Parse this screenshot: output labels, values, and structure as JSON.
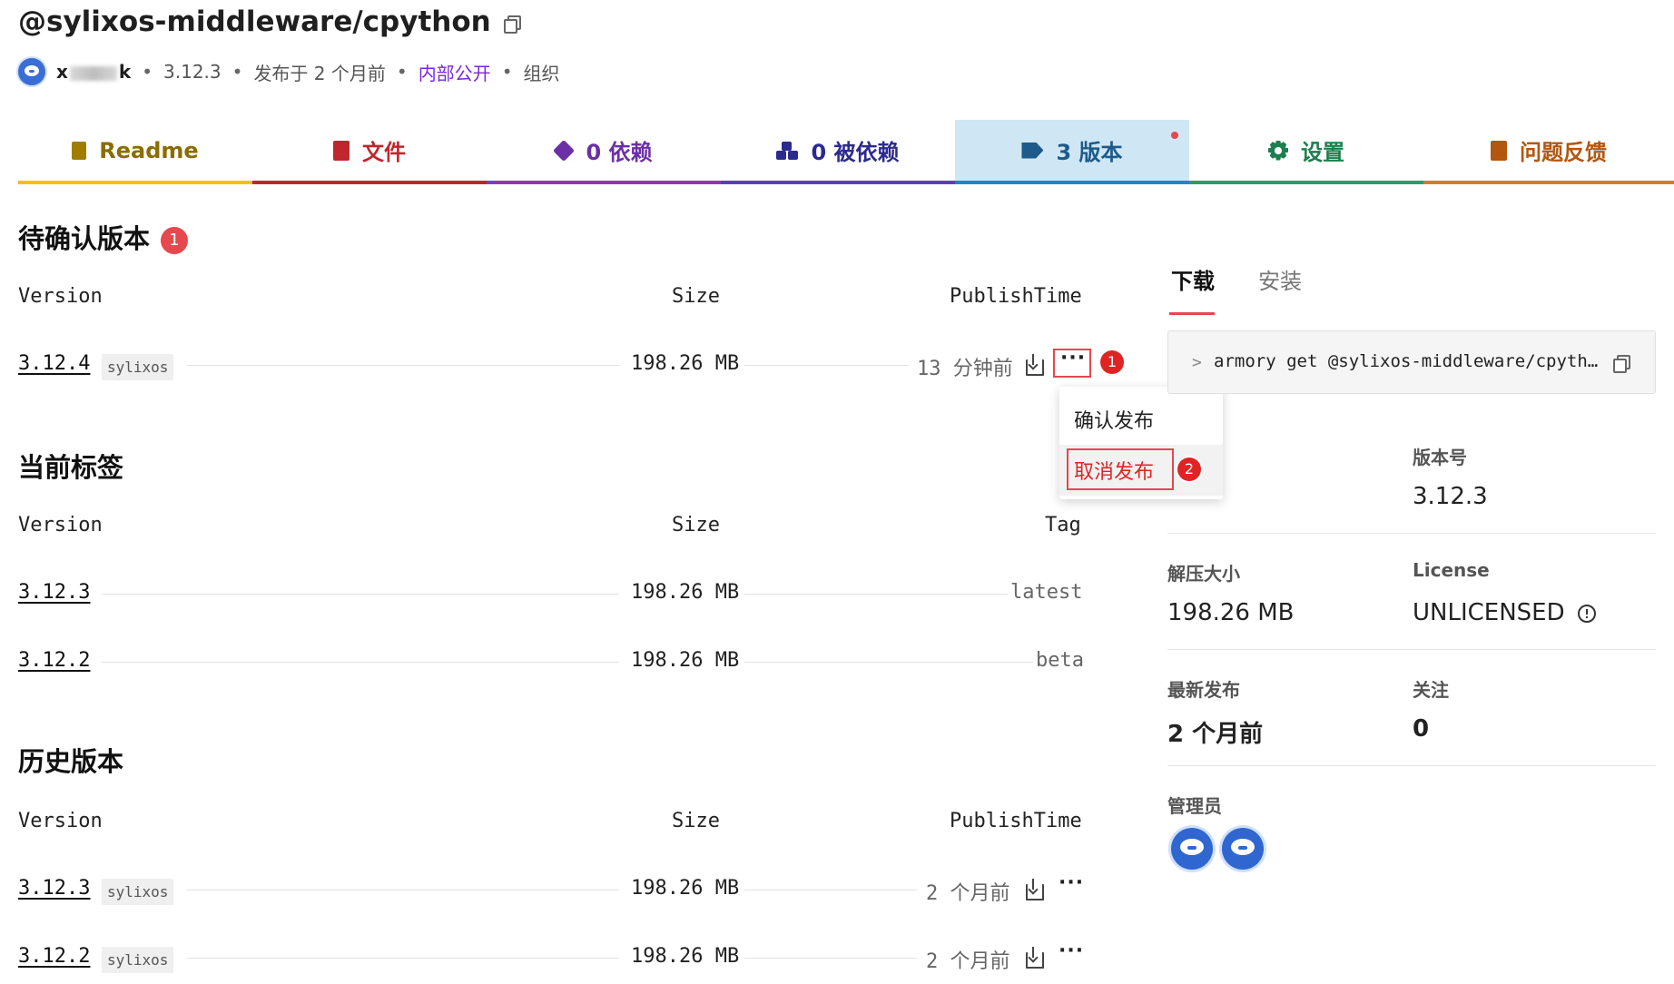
{
  "package": {
    "name": "@sylixos-middleware/cpython"
  },
  "meta": {
    "user_prefix": "x",
    "user_suffix": "k",
    "version": "3.12.3",
    "published": "发布于 2 个月前",
    "visibility": "内部公开",
    "owner_type": "组织",
    "sep": "•"
  },
  "tabs": [
    {
      "label": "Readme",
      "color": "#8a6d00",
      "bar": "#f2c200"
    },
    {
      "label": "文件",
      "color": "#c0262c",
      "bar": "#c0262c"
    },
    {
      "label": "0 依赖",
      "color": "#6b2fa6",
      "bar": "#8a3ab9"
    },
    {
      "label": "0 被依赖",
      "color": "#2b2a8f",
      "bar": "#5b3dc2"
    },
    {
      "label": "3 版本",
      "color": "#1e5a8a",
      "bar": "#1e87c8"
    },
    {
      "label": "设置",
      "color": "#1d7f4e",
      "bar": "#21a366"
    },
    {
      "label": "问题反馈",
      "color": "#b3560f",
      "bar": "#e07a1f"
    }
  ],
  "pending": {
    "title": "待确认版本",
    "count": "1",
    "headers": {
      "version": "Version",
      "size": "Size",
      "time": "PublishTime"
    },
    "rows": [
      {
        "version": "3.12.4",
        "chip": "sylixos",
        "size": "198.26 MB",
        "time": "13 分钟前"
      }
    ],
    "more_label": "···",
    "step1": "1"
  },
  "menu": {
    "items": [
      "确认发布",
      "取消发布"
    ],
    "step2": "2"
  },
  "tags": {
    "title": "当前标签",
    "headers": {
      "version": "Version",
      "size": "Size",
      "tag": "Tag"
    },
    "rows": [
      {
        "version": "3.12.3",
        "size": "198.26 MB",
        "tag": "latest"
      },
      {
        "version": "3.12.2",
        "size": "198.26 MB",
        "tag": "beta"
      }
    ]
  },
  "history": {
    "title": "历史版本",
    "headers": {
      "version": "Version",
      "size": "Size",
      "time": "PublishTime"
    },
    "rows": [
      {
        "version": "3.12.3",
        "chip": "sylixos",
        "size": "198.26 MB",
        "time": "2 个月前",
        "more": "···"
      },
      {
        "version": "3.12.2",
        "chip": "sylixos",
        "size": "198.26 MB",
        "time": "2 个月前",
        "more": "···"
      }
    ]
  },
  "side": {
    "tabs": [
      "下载",
      "安装"
    ],
    "command_prompt": ">",
    "command": "armory get @sylixos-middleware/cpyth…",
    "info": {
      "version_label": "版本号",
      "version_value": "3.12.3",
      "unpacked_label": "解压大小",
      "unpacked_value": "198.26 MB",
      "license_label": "License",
      "license_value": "UNLICENSED",
      "latest_label": "最新发布",
      "latest_value": "2 个月前",
      "follow_label": "关注",
      "follow_value": "0",
      "admins_label": "管理员"
    }
  },
  "colors": {
    "accent_red": "#e5484d",
    "active_tab_bg": "#cfe7f5",
    "visibility_purple": "#7a28d8"
  }
}
